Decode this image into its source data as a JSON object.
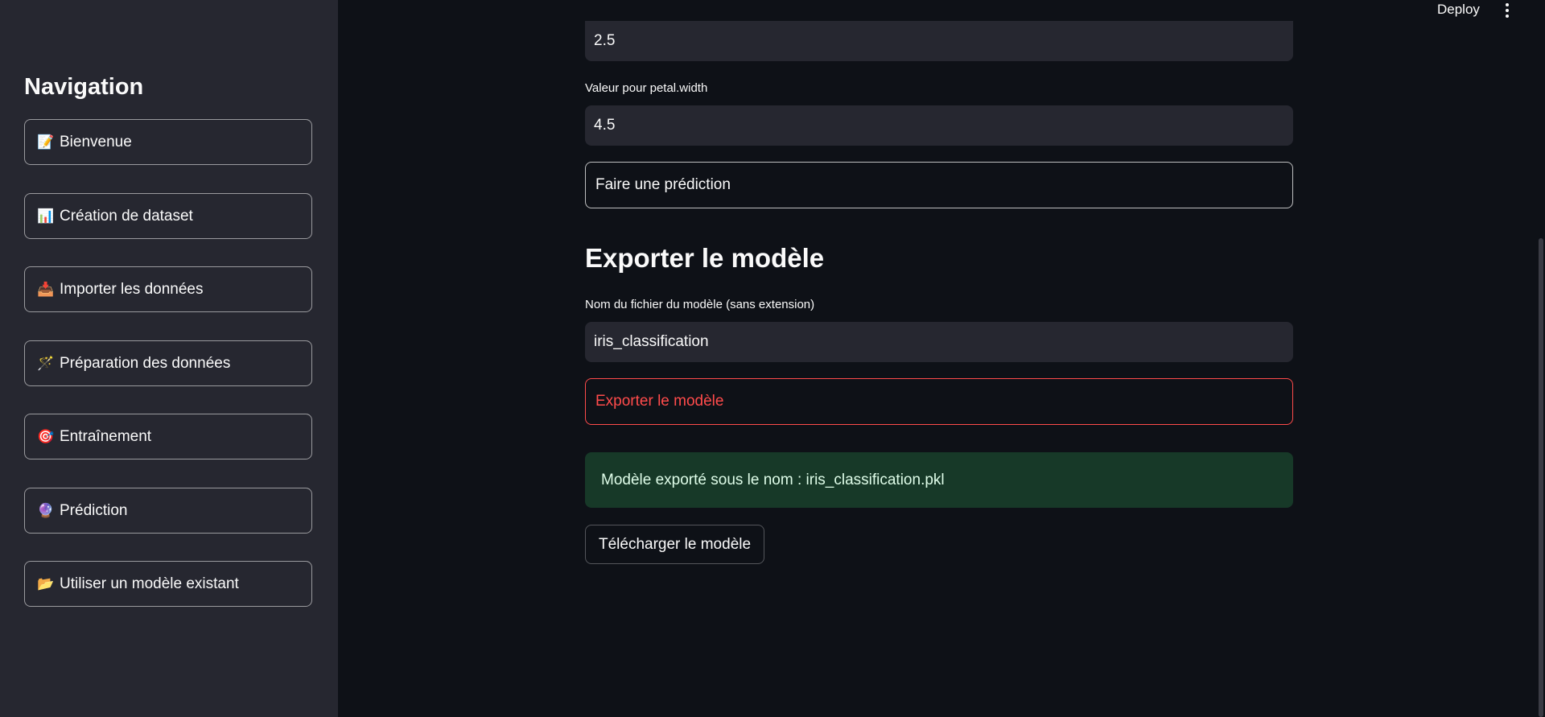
{
  "header": {
    "deploy_label": "Deploy",
    "menu_icon": "kebab-menu-icon"
  },
  "sidebar": {
    "title": "Navigation",
    "items": [
      {
        "icon": "📝",
        "icon_name": "memo-icon",
        "label": "Bienvenue"
      },
      {
        "icon": "📊",
        "icon_name": "bar-chart-icon",
        "label": "Création de dataset"
      },
      {
        "icon": "📥",
        "icon_name": "inbox-tray-icon",
        "label": "Importer les données"
      },
      {
        "icon": "🪄",
        "icon_name": "magic-wand-icon",
        "label": "Préparation des données"
      },
      {
        "icon": "🎯",
        "icon_name": "target-icon",
        "label": "Entraînement"
      },
      {
        "icon": "🔮",
        "icon_name": "crystal-ball-icon",
        "label": "Prédiction"
      },
      {
        "icon": "📂",
        "icon_name": "open-folder-icon",
        "label": "Utiliser un modèle existant"
      }
    ]
  },
  "main": {
    "prev_input_value": "2.5",
    "petal_width_label": "Valeur pour petal.width",
    "petal_width_value": "4.5",
    "predict_button": "Faire une prédiction",
    "export_heading": "Exporter le modèle",
    "filename_label": "Nom du fichier du modèle (sans extension)",
    "filename_value": "iris_classification",
    "export_button": "Exporter le modèle",
    "success_message": "Modèle exporté sous le nom : iris_classification.pkl",
    "download_button": "Télécharger le modèle"
  },
  "colors": {
    "background": "#0e1117",
    "sidebar": "#262730",
    "accent_red": "#ff4b4b",
    "success_bg": "#173928",
    "success_text": "#dffde9"
  }
}
